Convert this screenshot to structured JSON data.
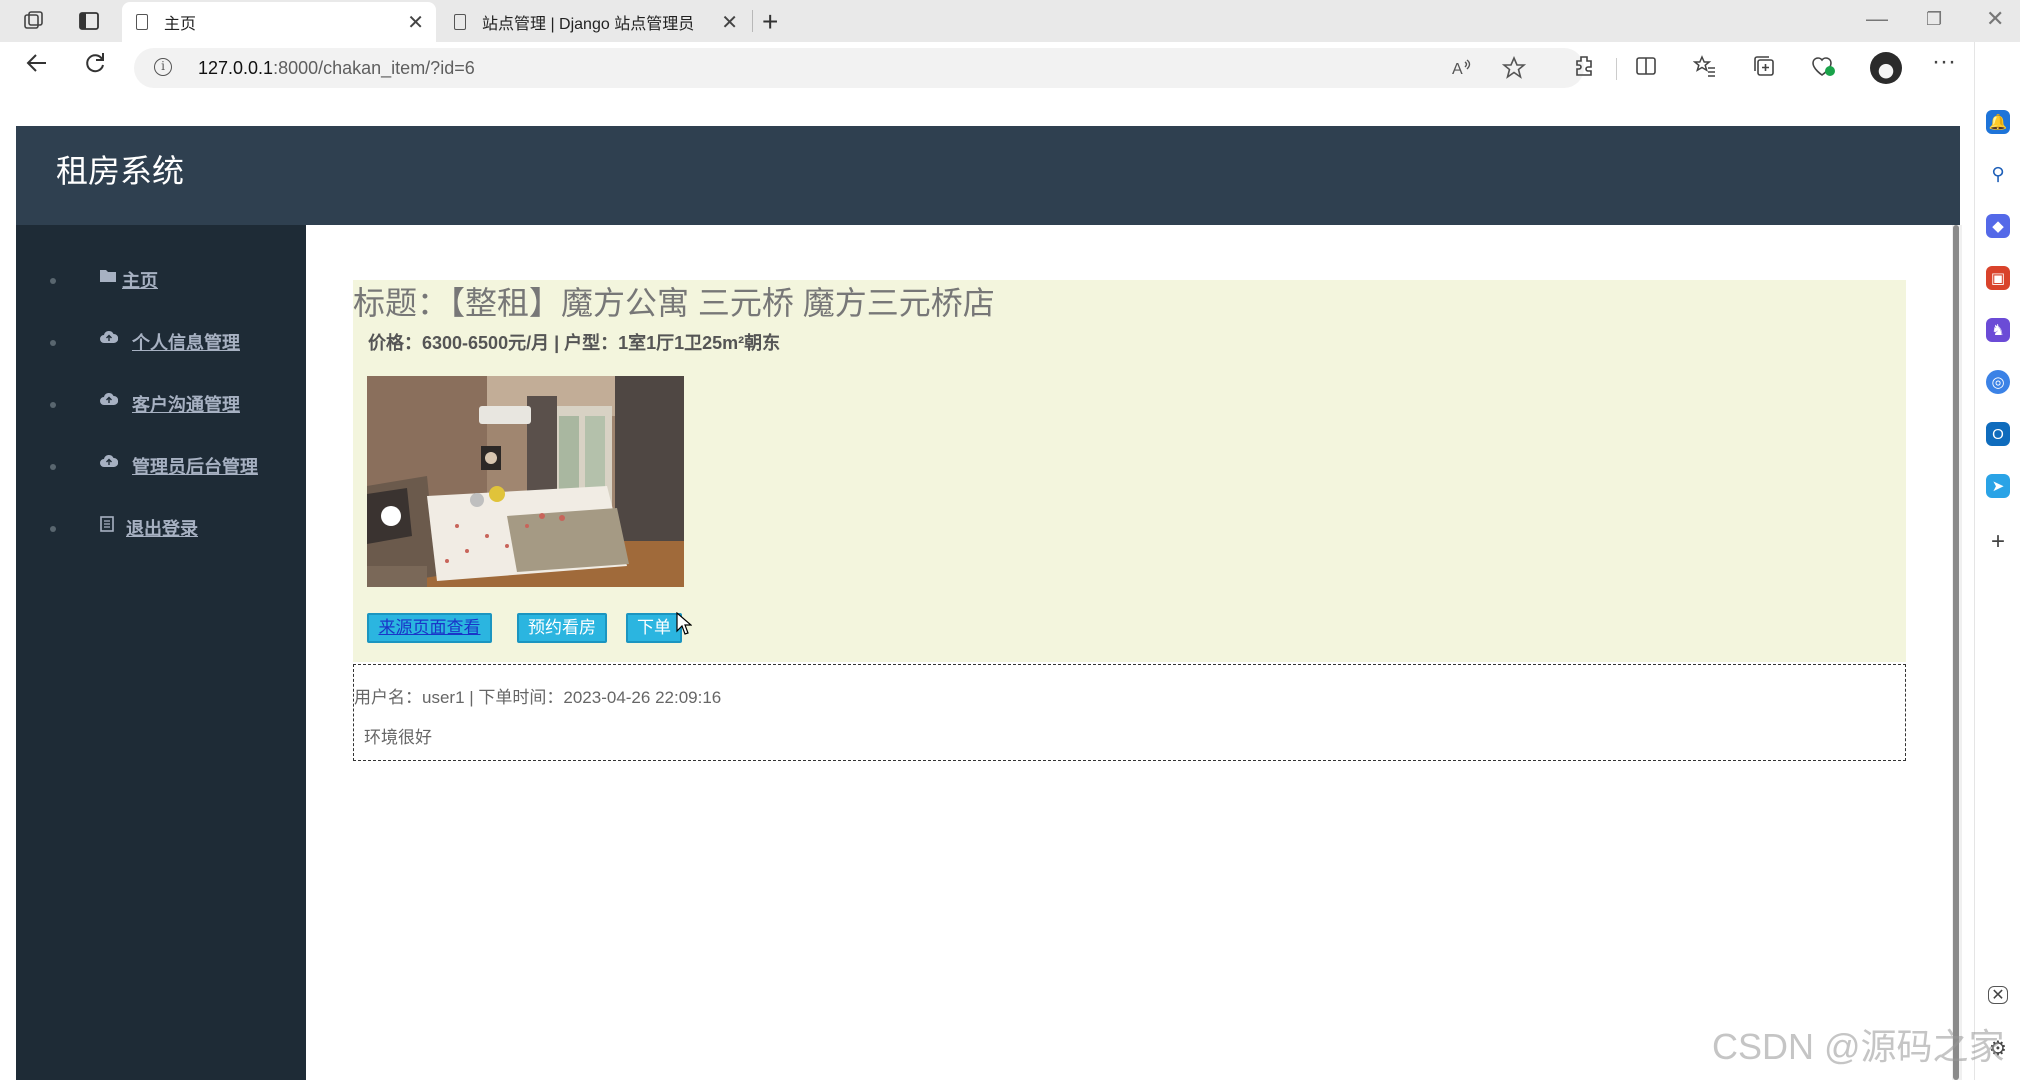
{
  "browser": {
    "tabs": [
      {
        "title": "主页",
        "active": true
      },
      {
        "title": "站点管理 | Django 站点管理员",
        "active": false
      }
    ],
    "address": {
      "host": "127.0.0.1",
      "rest": ":8000/chakan_item/?id=6"
    },
    "icons": [
      "workspaces-icon",
      "tab-actions-icon",
      "back-icon",
      "refresh-icon",
      "info-icon",
      "read-aloud-icon",
      "favorite-star-icon",
      "extensions-icon",
      "split-screen-icon",
      "favorites-icon",
      "collections-icon",
      "browser-essentials-icon",
      "profile-avatar",
      "more-icon"
    ]
  },
  "app": {
    "brand": "租房系统",
    "menu": [
      {
        "label": "主页",
        "icon": "folder-icon"
      },
      {
        "label": "个人信息管理",
        "icon": "cloud-icon"
      },
      {
        "label": "客户沟通管理",
        "icon": "cloud-icon"
      },
      {
        "label": "管理员后台管理",
        "icon": "cloud-icon"
      },
      {
        "label": "退出登录",
        "icon": "document-icon"
      }
    ]
  },
  "listing": {
    "title": "标题：【整租】魔方公寓 三元桥 魔方三元桥店",
    "meta": "价格：6300-6500元/月  |  户型：1室1厅1卫25m²朝东",
    "buttons": {
      "source": "来源页面查看",
      "appointment": "预约看房",
      "order": "下单"
    }
  },
  "review": {
    "line": "用户名：user1   |   下单时间：2023-04-26 22:09:16",
    "comment": "环境很好"
  },
  "watermark": "CSDN @源码之家",
  "colors": {
    "header": "#2f4050",
    "sidebar": "#1e2b36",
    "card": "#f3f5dd",
    "button": "#2bb5e0"
  }
}
